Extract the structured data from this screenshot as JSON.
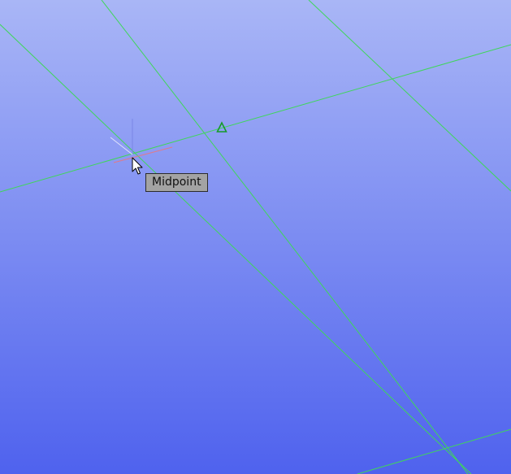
{
  "viewport": {
    "background_top": "#a9b6f6",
    "background_bottom": "#4f62ee"
  },
  "grid": {
    "line_color": "#3fd65a"
  },
  "snap": {
    "marker": "midpoint-triangle-icon",
    "marker_color": "#169a2a",
    "tooltip": "Midpoint"
  },
  "ucs_axes": {
    "x_color": "#e07a8a",
    "y_color": "#7a86e6",
    "z_color": "#dfe3fb"
  },
  "cursor": {
    "icon": "arrow-pointer-icon"
  }
}
